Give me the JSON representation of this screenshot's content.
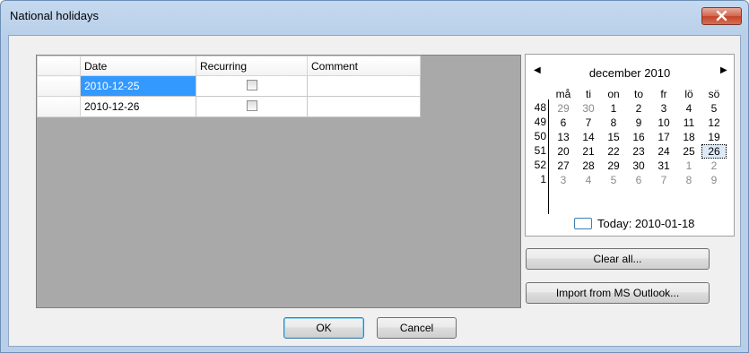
{
  "window": {
    "title": "National holidays"
  },
  "grid": {
    "columns": [
      "Date",
      "Recurring",
      "Comment"
    ],
    "rows": [
      {
        "date": "2010-12-25",
        "recurring": false,
        "comment": ""
      },
      {
        "date": "2010-12-26",
        "recurring": false,
        "comment": ""
      }
    ]
  },
  "calendar": {
    "month_label": "december 2010",
    "weekdays": [
      "må",
      "ti",
      "on",
      "to",
      "fr",
      "lö",
      "sö"
    ],
    "weeks": [
      {
        "week": "48",
        "days": [
          "29",
          "30",
          "1",
          "2",
          "3",
          "4",
          "5"
        ]
      },
      {
        "week": "49",
        "days": [
          "6",
          "7",
          "8",
          "9",
          "10",
          "11",
          "12"
        ]
      },
      {
        "week": "50",
        "days": [
          "13",
          "14",
          "15",
          "16",
          "17",
          "18",
          "19"
        ]
      },
      {
        "week": "51",
        "days": [
          "20",
          "21",
          "22",
          "23",
          "24",
          "25",
          "26"
        ]
      },
      {
        "week": "52",
        "days": [
          "27",
          "28",
          "29",
          "30",
          "31",
          "1",
          "2"
        ]
      },
      {
        "week": "1",
        "days": [
          "3",
          "4",
          "5",
          "6",
          "7",
          "8",
          "9"
        ]
      }
    ],
    "today_label": "Today: 2010-01-18"
  },
  "buttons": {
    "clear_all": "Clear all...",
    "import": "Import from MS Outlook...",
    "ok": "OK",
    "cancel": "Cancel"
  },
  "colors": {
    "selection": "#3399ff",
    "grid_background": "#a9a9a9",
    "window_frame": "#b9cfe9"
  }
}
